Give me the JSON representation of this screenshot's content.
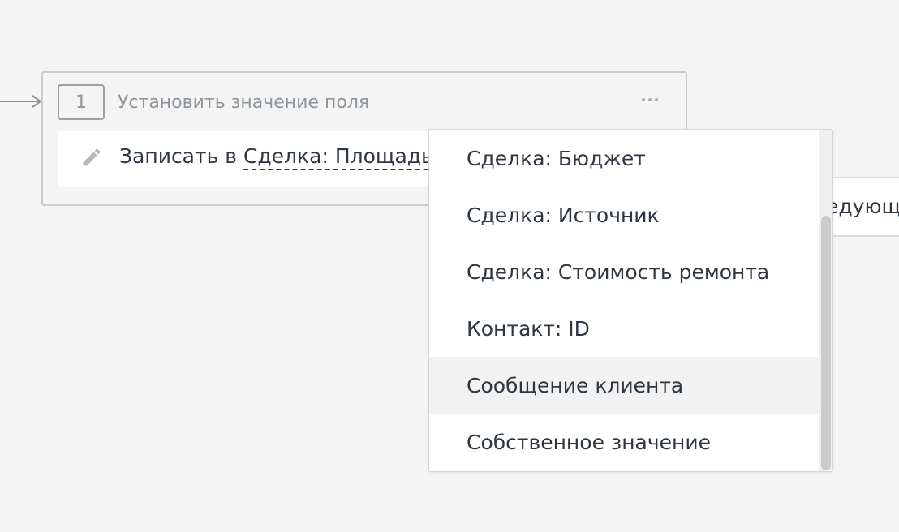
{
  "step": {
    "number": "1",
    "title": "Установить значение поля",
    "action_prefix": "Записать в ",
    "field_label": "Сделка: Площадь н",
    "more_icon": "more-horizontal-icon",
    "edit_icon": "pencil-icon"
  },
  "next_step": {
    "label_fragment": "едующ"
  },
  "dropdown": {
    "items": [
      {
        "label": "Сделка: Бюджет"
      },
      {
        "label": "Сделка: Источник"
      },
      {
        "label": "Сделка: Стоимость ремонта"
      },
      {
        "label": "Контакт: ID"
      },
      {
        "label": "Сообщение клиента",
        "hovered": true
      },
      {
        "label": "Собственное значение"
      }
    ]
  },
  "colors": {
    "background": "#f4f4f4",
    "card_border": "#c9cbcd",
    "text": "#2e3640",
    "muted_text": "#8e969c",
    "hover_row": "#f2f2f2",
    "scrollbar_thumb": "#cbcbcb"
  }
}
